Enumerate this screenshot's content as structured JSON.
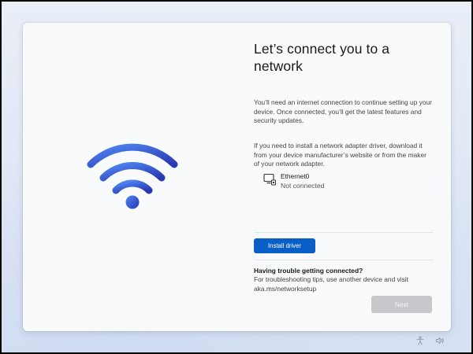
{
  "window": {
    "title": "Let’s connect you to a network"
  },
  "content": {
    "paragraph1": "You’ll need an internet connection to continue setting up your device. Once connected, you’ll get the latest features and security updates.",
    "paragraph2": "If you need to install a network adapter driver, download it from your device manufacturer’s website or from the maker of your network adapter."
  },
  "network": {
    "name": "Ethernet0",
    "status": "Not connected",
    "icon": "ethernet-pc-icon"
  },
  "actions": {
    "install_driver_label": "Install driver",
    "next_label": "Next"
  },
  "trouble": {
    "title": "Having trouble getting connected?",
    "text": "For troubleshooting tips, use another device and visit aka.ms/networksetup"
  },
  "taskbar": {
    "icons": [
      "accessibility-icon",
      "volume-icon"
    ]
  },
  "colors": {
    "accent": "#0a5ec8",
    "wifi_gradient_start": "#4a7df0",
    "wifi_gradient_end": "#2c3fb8",
    "disabled_button": "#c7c8cc"
  }
}
